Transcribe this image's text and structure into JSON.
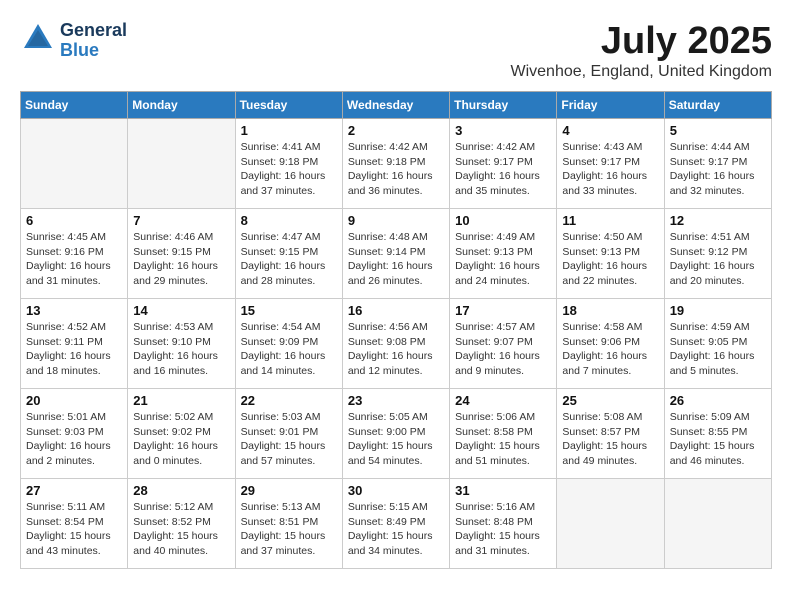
{
  "header": {
    "logo_general": "General",
    "logo_blue": "Blue",
    "month_title": "July 2025",
    "location": "Wivenhoe, England, United Kingdom"
  },
  "weekdays": [
    "Sunday",
    "Monday",
    "Tuesday",
    "Wednesday",
    "Thursday",
    "Friday",
    "Saturday"
  ],
  "weeks": [
    [
      {
        "day": "",
        "empty": true
      },
      {
        "day": "",
        "empty": true
      },
      {
        "day": "1",
        "sunrise": "4:41 AM",
        "sunset": "9:18 PM",
        "daylight": "16 hours and 37 minutes."
      },
      {
        "day": "2",
        "sunrise": "4:42 AM",
        "sunset": "9:18 PM",
        "daylight": "16 hours and 36 minutes."
      },
      {
        "day": "3",
        "sunrise": "4:42 AM",
        "sunset": "9:17 PM",
        "daylight": "16 hours and 35 minutes."
      },
      {
        "day": "4",
        "sunrise": "4:43 AM",
        "sunset": "9:17 PM",
        "daylight": "16 hours and 33 minutes."
      },
      {
        "day": "5",
        "sunrise": "4:44 AM",
        "sunset": "9:17 PM",
        "daylight": "16 hours and 32 minutes."
      }
    ],
    [
      {
        "day": "6",
        "sunrise": "4:45 AM",
        "sunset": "9:16 PM",
        "daylight": "16 hours and 31 minutes."
      },
      {
        "day": "7",
        "sunrise": "4:46 AM",
        "sunset": "9:15 PM",
        "daylight": "16 hours and 29 minutes."
      },
      {
        "day": "8",
        "sunrise": "4:47 AM",
        "sunset": "9:15 PM",
        "daylight": "16 hours and 28 minutes."
      },
      {
        "day": "9",
        "sunrise": "4:48 AM",
        "sunset": "9:14 PM",
        "daylight": "16 hours and 26 minutes."
      },
      {
        "day": "10",
        "sunrise": "4:49 AM",
        "sunset": "9:13 PM",
        "daylight": "16 hours and 24 minutes."
      },
      {
        "day": "11",
        "sunrise": "4:50 AM",
        "sunset": "9:13 PM",
        "daylight": "16 hours and 22 minutes."
      },
      {
        "day": "12",
        "sunrise": "4:51 AM",
        "sunset": "9:12 PM",
        "daylight": "16 hours and 20 minutes."
      }
    ],
    [
      {
        "day": "13",
        "sunrise": "4:52 AM",
        "sunset": "9:11 PM",
        "daylight": "16 hours and 18 minutes."
      },
      {
        "day": "14",
        "sunrise": "4:53 AM",
        "sunset": "9:10 PM",
        "daylight": "16 hours and 16 minutes."
      },
      {
        "day": "15",
        "sunrise": "4:54 AM",
        "sunset": "9:09 PM",
        "daylight": "16 hours and 14 minutes."
      },
      {
        "day": "16",
        "sunrise": "4:56 AM",
        "sunset": "9:08 PM",
        "daylight": "16 hours and 12 minutes."
      },
      {
        "day": "17",
        "sunrise": "4:57 AM",
        "sunset": "9:07 PM",
        "daylight": "16 hours and 9 minutes."
      },
      {
        "day": "18",
        "sunrise": "4:58 AM",
        "sunset": "9:06 PM",
        "daylight": "16 hours and 7 minutes."
      },
      {
        "day": "19",
        "sunrise": "4:59 AM",
        "sunset": "9:05 PM",
        "daylight": "16 hours and 5 minutes."
      }
    ],
    [
      {
        "day": "20",
        "sunrise": "5:01 AM",
        "sunset": "9:03 PM",
        "daylight": "16 hours and 2 minutes."
      },
      {
        "day": "21",
        "sunrise": "5:02 AM",
        "sunset": "9:02 PM",
        "daylight": "16 hours and 0 minutes."
      },
      {
        "day": "22",
        "sunrise": "5:03 AM",
        "sunset": "9:01 PM",
        "daylight": "15 hours and 57 minutes."
      },
      {
        "day": "23",
        "sunrise": "5:05 AM",
        "sunset": "9:00 PM",
        "daylight": "15 hours and 54 minutes."
      },
      {
        "day": "24",
        "sunrise": "5:06 AM",
        "sunset": "8:58 PM",
        "daylight": "15 hours and 51 minutes."
      },
      {
        "day": "25",
        "sunrise": "5:08 AM",
        "sunset": "8:57 PM",
        "daylight": "15 hours and 49 minutes."
      },
      {
        "day": "26",
        "sunrise": "5:09 AM",
        "sunset": "8:55 PM",
        "daylight": "15 hours and 46 minutes."
      }
    ],
    [
      {
        "day": "27",
        "sunrise": "5:11 AM",
        "sunset": "8:54 PM",
        "daylight": "15 hours and 43 minutes."
      },
      {
        "day": "28",
        "sunrise": "5:12 AM",
        "sunset": "8:52 PM",
        "daylight": "15 hours and 40 minutes."
      },
      {
        "day": "29",
        "sunrise": "5:13 AM",
        "sunset": "8:51 PM",
        "daylight": "15 hours and 37 minutes."
      },
      {
        "day": "30",
        "sunrise": "5:15 AM",
        "sunset": "8:49 PM",
        "daylight": "15 hours and 34 minutes."
      },
      {
        "day": "31",
        "sunrise": "5:16 AM",
        "sunset": "8:48 PM",
        "daylight": "15 hours and 31 minutes."
      },
      {
        "day": "",
        "empty": true
      },
      {
        "day": "",
        "empty": true
      }
    ]
  ]
}
